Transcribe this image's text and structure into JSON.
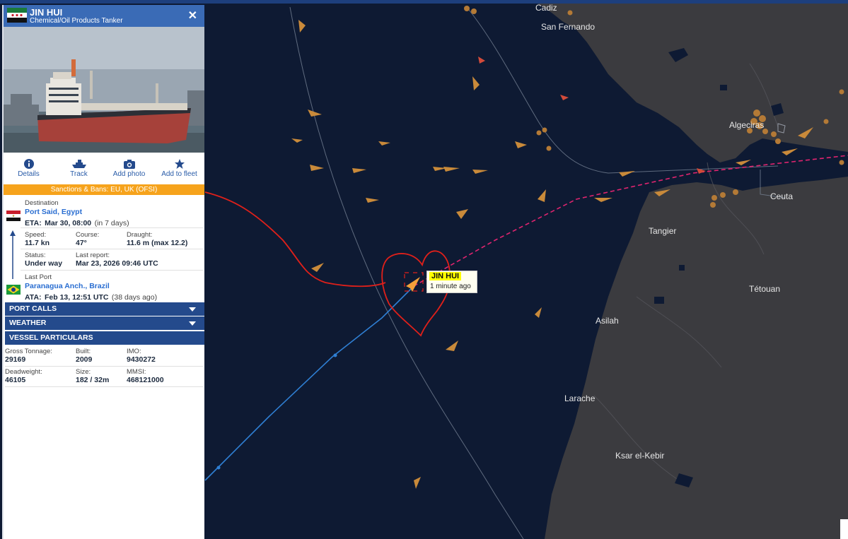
{
  "vessel": {
    "name": "JIN HUI",
    "type": "Chemical/Oil Products Tanker",
    "flag": "Syria"
  },
  "actions": [
    {
      "label": "Details",
      "icon": "info-icon"
    },
    {
      "label": "Track",
      "icon": "ship-icon"
    },
    {
      "label": "Add photo",
      "icon": "camera-icon"
    },
    {
      "label": "Add to fleet",
      "icon": "star-icon"
    }
  ],
  "sanctions": "Sanctions & Bans: EU, UK (OFSI)",
  "destination": {
    "label": "Destination",
    "port": "Port Said, Egypt",
    "eta_label": "ETA:",
    "eta": "Mar 30, 08:00",
    "eta_rel": "(in 7 days)"
  },
  "voyage": {
    "speed_label": "Speed:",
    "speed": "11.7 kn",
    "course_label": "Course:",
    "course": "47°",
    "draught_label": "Draught:",
    "draught": "11.6 m (max 12.2)",
    "status_label": "Status:",
    "status": "Under way",
    "last_report_label": "Last report:",
    "last_report": "Mar 23, 2026 09:46 UTC"
  },
  "last_port": {
    "label": "Last Port",
    "port": "Paranagua Anch., Brazil",
    "ata_label": "ATA:",
    "ata": "Feb 13, 12:51 UTC",
    "ata_rel": "(38 days ago)"
  },
  "sections": {
    "port_calls": "PORT CALLS",
    "weather": "WEATHER",
    "vessel_particulars": "VESSEL PARTICULARS"
  },
  "particulars": {
    "gross_tonnage_label": "Gross Tonnage:",
    "gross_tonnage": "29169",
    "built_label": "Built:",
    "built": "2009",
    "imo_label": "IMO:",
    "imo": "9430272",
    "deadweight_label": "Deadweight:",
    "deadweight": "46105",
    "size_label": "Size:",
    "size": "182 / 32m",
    "mmsi_label": "MMSI:",
    "mmsi": "468121000"
  },
  "map": {
    "places": [
      "Cadiz",
      "San Fernando",
      "Algeciras",
      "Ceuta",
      "Tangier",
      "Tétouan",
      "Asilah",
      "Larache",
      "Ksar el-Kebir"
    ],
    "tooltip": {
      "name": "JIN HUI",
      "time": "1 minute ago"
    }
  },
  "colors": {
    "header": "#3a6bb6",
    "section_bar": "#244a8c",
    "sanctions": "#f6a31c",
    "sea": "#0e1a33",
    "land": "#3b3b3f",
    "track_past": "#2f7fd3",
    "route_planned": "#e0246f",
    "hand_drawn_heart": "#e0201a",
    "vessel_marker": "#f2a13a"
  }
}
